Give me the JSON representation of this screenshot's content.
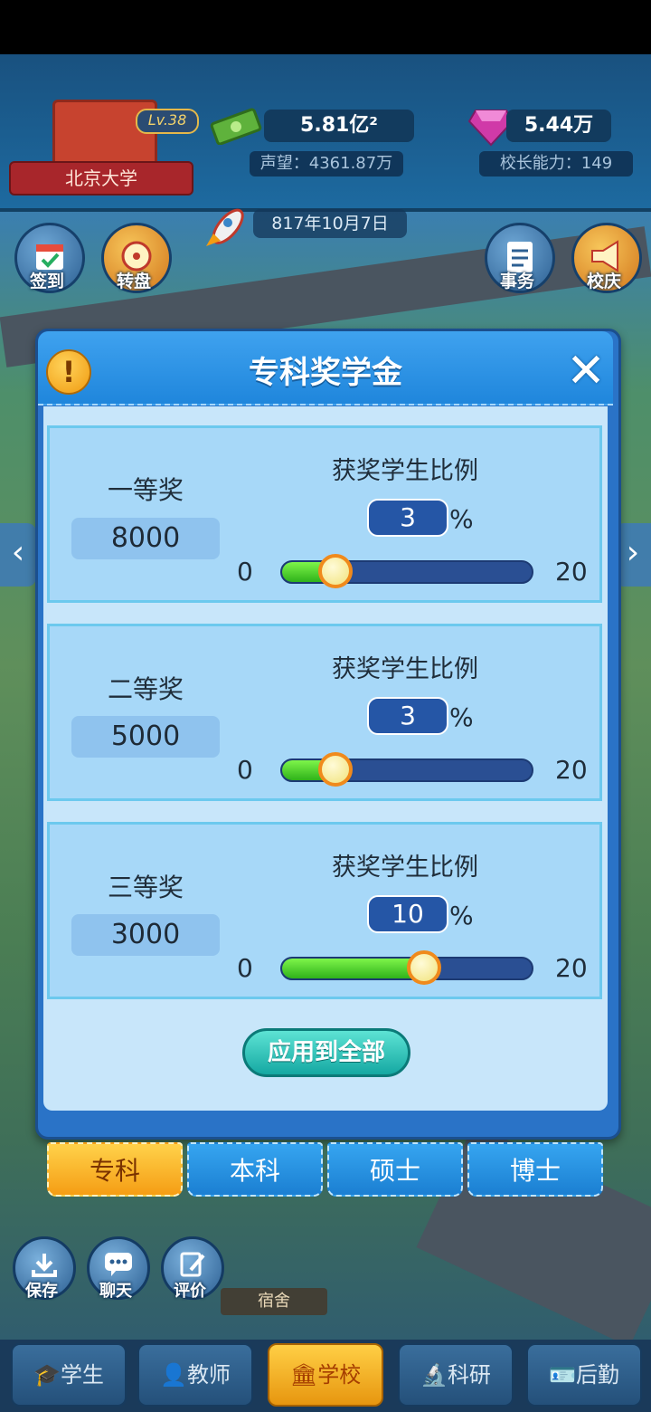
{
  "header": {
    "school_name": "北京大学",
    "level": "Lv.38",
    "money": "5.81亿²",
    "reputation": "声望：4361.87万",
    "gems": "5.44万",
    "principal_ability": "校长能力：149",
    "date": "817年10月7日"
  },
  "quick_buttons": {
    "checkin": "签到",
    "wheel": "转盘",
    "affairs": "事务",
    "anniversary": "校庆"
  },
  "dialog": {
    "title": "专科奖学金",
    "ratio_title": "获奖学生比例",
    "percent_sign": "%",
    "slider_min": "0",
    "slider_max": "20",
    "apply_all": "应用到全部",
    "prizes": [
      {
        "name": "一等奖",
        "amount": "8000",
        "ratio": "3"
      },
      {
        "name": "二等奖",
        "amount": "5000",
        "ratio": "3"
      },
      {
        "name": "三等奖",
        "amount": "3000",
        "ratio": "10"
      }
    ]
  },
  "tabs": [
    "专科",
    "本科",
    "硕士",
    "博士"
  ],
  "bottom_tools": {
    "save": "保存",
    "chat": "聊天",
    "rate": "评价",
    "dorm": "宿舍"
  },
  "nav": [
    "学生",
    "教师",
    "学校",
    "科研",
    "后勤"
  ],
  "colors": {
    "accent": "#1f86dc",
    "active_tab": "#f59d14",
    "slider_fill": "#2fb21a",
    "apply_button": "#15a8a2"
  }
}
